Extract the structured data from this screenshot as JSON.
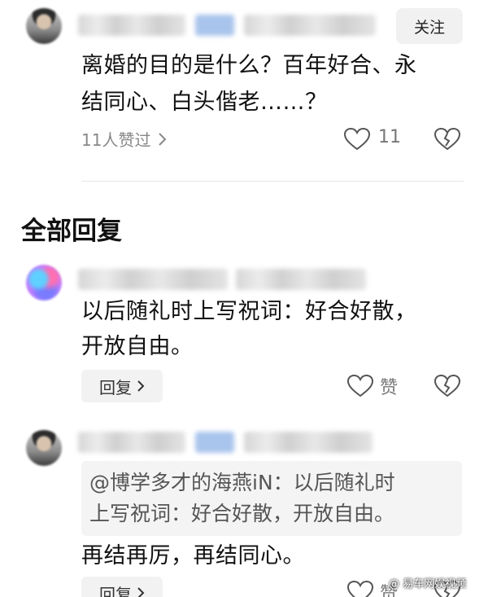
{
  "post": {
    "follow_label": "关注",
    "text_line1": "离婚的目的是什么？百年好合、永",
    "text_line2": "结同心、白头偕老……？",
    "likes_summary": "11人赞过",
    "like_count": "11"
  },
  "section": {
    "title": "全部回复"
  },
  "replies": [
    {
      "text_line1": "以后随礼时上写祝词：好合好散，",
      "text_line2": "开放自由。",
      "reply_label": "回复",
      "like_label": "赞"
    },
    {
      "quote_line1": "@博学多才的海燕iN：以后随礼时",
      "quote_line2": "上写祝词：好合好散，开放自由。",
      "text": "再结再厉，再结同心。",
      "reply_label": "回复",
      "like_label": "赞"
    }
  ],
  "watermark": "@ 易车网娱视频",
  "icons": {
    "like": "heart-outline-icon",
    "dislike": "broken-heart-icon",
    "chevron": "chevron-right-icon"
  }
}
